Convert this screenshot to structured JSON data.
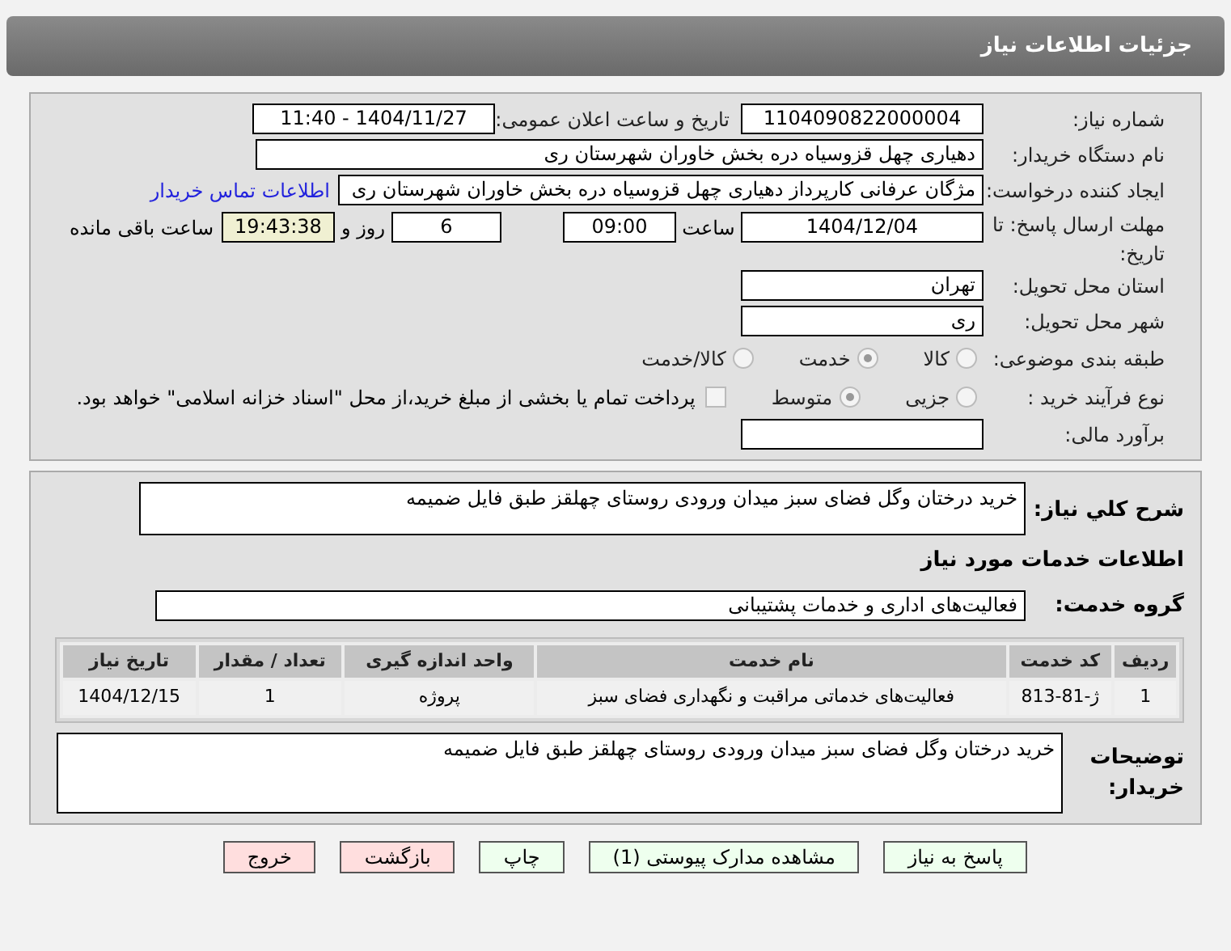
{
  "header": {
    "title": "جزئیات اطلاعات نیاز"
  },
  "details": {
    "need_number": {
      "label": "شماره نیاز:",
      "value": "1104090822000004"
    },
    "announce": {
      "label": "تاریخ و ساعت اعلان عمومی:",
      "value": "1404/11/27 - 11:40"
    },
    "buyer_org": {
      "label": "نام دستگاه خریدار:",
      "value": "دهیاری چهل قزوسیاه دره بخش خاوران شهرستان ری"
    },
    "creator": {
      "label": "ایجاد کننده درخواست:",
      "value": "مژگان  عرفانی کارپرداز دهیاری چهل قزوسیاه دره بخش خاوران شهرستان ری",
      "link": "اطلاعات تماس خریدار"
    },
    "deadline": {
      "label": "مهلت ارسال پاسخ: تا تاریخ:",
      "date": "1404/12/04",
      "time_label": "ساعت",
      "time": "09:00",
      "days": "6",
      "days_label": "روز و",
      "remaining": "19:43:38",
      "remaining_label": "ساعت باقی مانده"
    },
    "province": {
      "label": "استان محل تحویل:",
      "value": "تهران"
    },
    "city": {
      "label": "شهر محل تحویل:",
      "value": "ری"
    },
    "category": {
      "label": "طبقه بندی موضوعی:",
      "options": [
        {
          "label": "کالا",
          "selected": false
        },
        {
          "label": "خدمت",
          "selected": true
        },
        {
          "label": "کالا/خدمت",
          "selected": false
        }
      ]
    },
    "process": {
      "label": "نوع فرآیند خرید :",
      "options": [
        {
          "label": "جزیی",
          "selected": false
        },
        {
          "label": "متوسط",
          "selected": true
        }
      ],
      "payment": {
        "checked": false,
        "text": "پرداخت تمام یا بخشی از مبلغ خرید،از محل \"اسناد خزانه اسلامی\" خواهد بود."
      }
    },
    "budget": {
      "label": "برآورد مالی:"
    }
  },
  "services": {
    "summary_label": "شرح کلي نياز:",
    "summary": "خرید درختان وگل فضای سبز میدان ورودی روستای چهلقز طبق فایل ضمیمه",
    "heading": "اطلاعات خدمات مورد نیاز",
    "group_label": "گروه خدمت:",
    "group": "فعالیت‌های اداری و خدمات پشتیبانی",
    "table": {
      "columns": [
        "ردیف",
        "کد خدمت",
        "نام خدمت",
        "واحد اندازه گیری",
        "تعداد / مقدار",
        "تاریخ نیاز"
      ],
      "rows": [
        [
          "1",
          "ژ-81-813",
          "فعالیت‌های خدماتی مراقبت و نگهداری فضای سبز",
          "پروژه",
          "1",
          "1404/12/15"
        ]
      ]
    },
    "notes_label": "توضیحات خریدار:",
    "notes": "خرید درختان وگل فضای سبز میدان ورودی روستای چهلقز طبق فایل ضمیمه"
  },
  "buttons": [
    {
      "label": "پاسخ به نیاز",
      "kind": "primary"
    },
    {
      "label": "مشاهده مدارک پیوستی (1)",
      "kind": "primary"
    },
    {
      "label": "چاپ",
      "kind": "primary"
    },
    {
      "label": "بازگشت",
      "kind": "danger"
    },
    {
      "label": "خروج",
      "kind": "danger"
    }
  ]
}
